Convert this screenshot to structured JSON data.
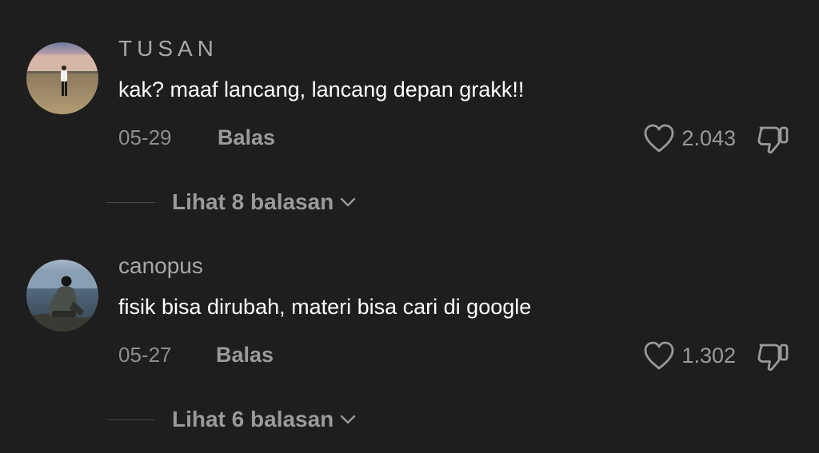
{
  "comments": [
    {
      "username": "TUSAN",
      "text": "kak? maaf lancang, lancang depan grakk!!",
      "date": "05-29",
      "reply_label": "Balas",
      "likes": "2.043",
      "view_replies_label": "Lihat 8 balasan",
      "avatar_icon": "avatar-person-beach-photo",
      "like_icon": "heart-outline-icon",
      "dislike_icon": "thumbs-down-outline-icon"
    },
    {
      "username": "canopus",
      "text": "fisik bisa dirubah, materi bisa cari di google",
      "date": "05-27",
      "reply_label": "Balas",
      "likes": "1.302",
      "view_replies_label": "Lihat 6 balasan",
      "avatar_icon": "avatar-person-sitting-sea-photo",
      "like_icon": "heart-outline-icon",
      "dislike_icon": "thumbs-down-outline-icon"
    }
  ],
  "colors": {
    "background": "#1e1e1e",
    "primary_text": "#ffffff",
    "secondary_text": "#9a9a9a",
    "username_text": "#a8a8a8"
  }
}
